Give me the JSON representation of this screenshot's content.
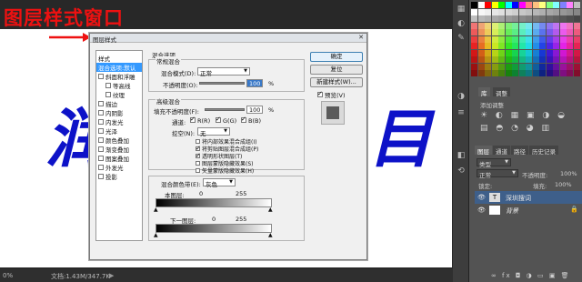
{
  "banner": {
    "text": "图层样式窗口"
  },
  "canvas": {
    "chars": [
      "润",
      "目"
    ]
  },
  "status": {
    "zoom": "0%",
    "doc": "文档:1.43M/347.7K"
  },
  "dialog": {
    "title": "图层样式",
    "left_items": [
      {
        "label": "样式",
        "checkbox": false,
        "selected": false,
        "indent": false
      },
      {
        "label": "混合选项:默认",
        "checkbox": false,
        "selected": true,
        "indent": false
      },
      {
        "label": "斜面和浮雕",
        "checkbox": true,
        "selected": false,
        "indent": false
      },
      {
        "label": "等高线",
        "checkbox": true,
        "selected": false,
        "indent": true
      },
      {
        "label": "纹理",
        "checkbox": true,
        "selected": false,
        "indent": true
      },
      {
        "label": "描边",
        "checkbox": true,
        "selected": false,
        "indent": false
      },
      {
        "label": "内阴影",
        "checkbox": true,
        "selected": false,
        "indent": false
      },
      {
        "label": "内发光",
        "checkbox": true,
        "selected": false,
        "indent": false
      },
      {
        "label": "光泽",
        "checkbox": true,
        "selected": false,
        "indent": false
      },
      {
        "label": "颜色叠加",
        "checkbox": true,
        "selected": false,
        "indent": false
      },
      {
        "label": "渐变叠加",
        "checkbox": true,
        "selected": false,
        "indent": false
      },
      {
        "label": "图案叠加",
        "checkbox": true,
        "selected": false,
        "indent": false
      },
      {
        "label": "外发光",
        "checkbox": true,
        "selected": false,
        "indent": false
      },
      {
        "label": "投影",
        "checkbox": true,
        "selected": false,
        "indent": false
      }
    ],
    "blend_options_header": "混合选项",
    "general_blend": "常规混合",
    "blend_mode_label": "混合模式(D):",
    "blend_mode_value": "正常",
    "opacity_label": "不透明度(O):",
    "opacity_value": "100",
    "percent": "%",
    "advanced_blend": "高级混合",
    "fill_opacity_label": "填充不透明度(F):",
    "fill_opacity_value": "100",
    "channels_label": "通道:",
    "channel_r": "R(R)",
    "channel_g": "G(G)",
    "channel_b": "B(B)",
    "knockout_label": "挖空(N):",
    "knockout_value": "无",
    "checks": [
      {
        "label": "将内部效果混合成组(I)",
        "checked": false
      },
      {
        "label": "将剪贴图层混合成组(P)",
        "checked": true
      },
      {
        "label": "透明形状图层(T)",
        "checked": true
      },
      {
        "label": "图层蒙版隐藏效果(S)",
        "checked": false
      },
      {
        "label": "矢量蒙版隐藏效果(H)",
        "checked": false
      }
    ],
    "blend_if_label": "混合颜色带(E):",
    "blend_if_value": "灰色",
    "this_layer_label": "本图层:",
    "this_layer_min": "0",
    "this_layer_max": "255",
    "under_layer_label": "下一图层:",
    "under_layer_min": "0",
    "under_layer_max": "255",
    "btn_ok": "确定",
    "btn_reset": "复位",
    "btn_new_style": "新建样式(W)...",
    "preview_label": "预览(V)"
  },
  "panel": {
    "tab_adjust_a": "库",
    "tab_adjust_b": "调整",
    "add_adjust": "添加调整",
    "layer_tabs": [
      "图层",
      "通道",
      "路径",
      "历史记录"
    ],
    "kind": "类型",
    "mode": "正常",
    "opacity_label": "不透明度:",
    "opacity_value": "100%",
    "lock_label": "锁定:",
    "fill_label": "填充:",
    "fill_value": "100%",
    "layers": [
      {
        "name": "深圳搜词",
        "type": "text"
      },
      {
        "name": "背景",
        "type": "bg"
      }
    ],
    "footer_icons": "∞ fx ◘ ◑ ▭ ▣ 🗑"
  },
  "swatch_colors": [
    "#000000",
    "#ffffff",
    "#ff0000",
    "#ffff00",
    "#00ff00",
    "#00ffff",
    "#0000ff",
    "#ff00ff",
    "#ff8080",
    "#ffc080",
    "#ffff80",
    "#80ff80",
    "#80ffff",
    "#8080ff",
    "#ff80ff",
    "#c0c0c0"
  ],
  "accent": {
    "red": "#ee1111",
    "blue": "#0d12c8"
  }
}
